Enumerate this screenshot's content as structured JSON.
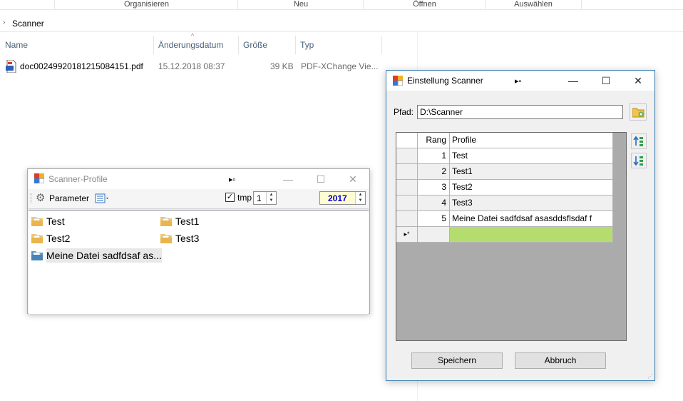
{
  "ribbon": {
    "groups": [
      "Organisieren",
      "Neu",
      "Öffnen",
      "Auswählen"
    ]
  },
  "address": {
    "chevron": "›",
    "path": "Scanner"
  },
  "columns": {
    "name": "Name",
    "date": "Änderungsdatum",
    "size": "Größe",
    "type": "Typ"
  },
  "files": [
    {
      "name": "doc00249920181215084151.pdf",
      "date": "15.12.2018 08:37",
      "size": "39 KB",
      "type": "PDF-XChange Vie..."
    }
  ],
  "scanner_profile": {
    "title": "Scanner-Profile",
    "parameter_label": "Parameter",
    "tmp_label": "tmp",
    "tmp_checked": true,
    "tmp_value": "1",
    "year": "2017",
    "items": [
      "Test",
      "Test1",
      "Test2",
      "Test3",
      "Meine Datei sadfdsaf as..."
    ]
  },
  "settings": {
    "title": "Einstellung Scanner",
    "path_label": "Pfad:",
    "path_value": "D:\\Scanner",
    "grid": {
      "headers": [
        "Rang",
        "Profile"
      ],
      "rows": [
        {
          "rang": "1",
          "profile": "Test"
        },
        {
          "rang": "2",
          "profile": "Test1"
        },
        {
          "rang": "3",
          "profile": "Test2"
        },
        {
          "rang": "4",
          "profile": "Test3"
        },
        {
          "rang": "5",
          "profile": "Meine Datei sadfdsaf asasddsflsdaf f"
        }
      ],
      "new_row_marker": "▸*"
    },
    "save_label": "Speichern",
    "cancel_label": "Abbruch"
  },
  "window_controls": {
    "minimize": "—",
    "maximize": "☐",
    "close": "✕",
    "pin": "▸▫"
  },
  "colors": {
    "year_text": "#0000cc",
    "new_row_fill": "#b5dc6f",
    "accent_border": "#3c7fb1"
  }
}
